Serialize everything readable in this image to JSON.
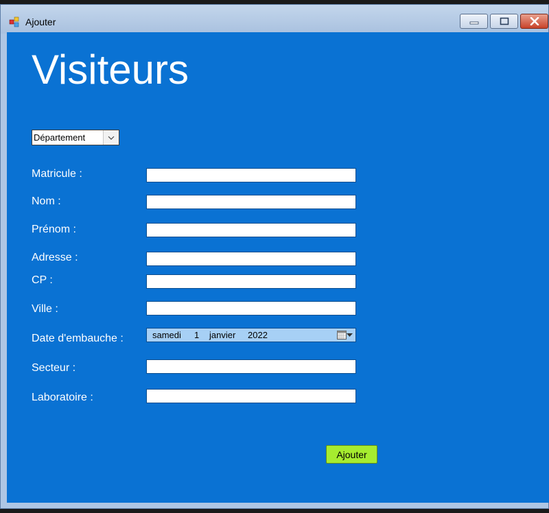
{
  "window": {
    "title": "Ajouter",
    "colors": {
      "client": "#0a72d3",
      "submit": "#a6ec2f",
      "date_bg": "#a7d0f5"
    }
  },
  "heading": "Visiteurs",
  "department_select": {
    "selected": "Département"
  },
  "form": {
    "fields": [
      {
        "label": "Matricule :",
        "value": ""
      },
      {
        "label": "Nom :",
        "value": ""
      },
      {
        "label": "Prénom :",
        "value": ""
      },
      {
        "label": "Adresse :",
        "value": ""
      },
      {
        "label": "CP :",
        "value": ""
      },
      {
        "label": "Ville :",
        "value": ""
      },
      {
        "label": "Date d'embauche :"
      },
      {
        "label": "Secteur :",
        "value": ""
      },
      {
        "label": "Laboratoire :",
        "value": ""
      }
    ],
    "hire_date": {
      "weekday": "samedi",
      "day": "1",
      "month": "janvier",
      "year": "2022"
    }
  },
  "submit_label": "Ajouter"
}
